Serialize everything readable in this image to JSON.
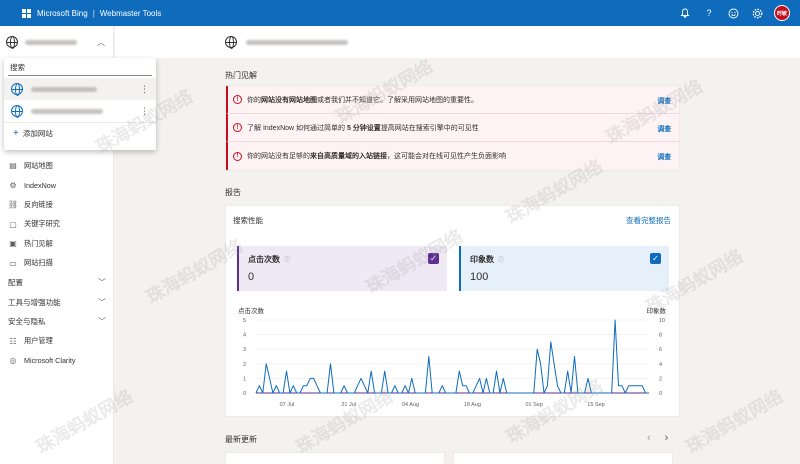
{
  "topbar": {
    "brand": "Microsoft Bing",
    "product": "Webmaster Tools",
    "avatar_initials": "时敏",
    "icons": [
      "bell-icon",
      "help-icon",
      "feedback-icon",
      "settings-icon"
    ],
    "color": "#0f6cbd"
  },
  "sidebar": {
    "dropdown": {
      "search_label": "搜索",
      "add_site": "添加网站"
    },
    "nav_items": [
      {
        "label": "网站地图",
        "icon": "sitemap-icon"
      },
      {
        "label": "IndexNow",
        "icon": "indexnow-icon"
      },
      {
        "label": "反向链接",
        "icon": "backlinks-icon"
      },
      {
        "label": "关键字研究",
        "icon": "keyword-research-icon"
      },
      {
        "label": "热门见解",
        "icon": "insights-icon"
      },
      {
        "label": "网站扫描",
        "icon": "site-scan-icon"
      }
    ],
    "nav_groups": [
      {
        "label": "配置"
      },
      {
        "label": "工具与增强功能"
      },
      {
        "label": "安全与隐私"
      }
    ],
    "nav_tail": [
      {
        "label": "用户管理",
        "icon": "user-management-icon"
      },
      {
        "label": "Microsoft Clarity",
        "icon": "clarity-icon"
      }
    ]
  },
  "insights": {
    "title": "热门见解",
    "rows": [
      {
        "pre": "你的",
        "bold": "网站没有网站地图",
        "post": "或者我们并不知道它。了解采用网站地图的重要性。",
        "action": "调查"
      },
      {
        "pre": "了解 IndexNow 如何通过简单的 ",
        "bold": "5 分钟设置",
        "post": "提高网站在搜索引擎中的可见性",
        "action": "调查"
      },
      {
        "pre": "你的网站没有足够的",
        "bold": "来自高质量域的入站链接",
        "post": "，这可能会对在线可见性产生负面影响",
        "action": "调查"
      }
    ]
  },
  "report": {
    "title": "报告",
    "card_title": "搜索性能",
    "link": "查看完整报告",
    "clicks": {
      "label": "点击次数",
      "value": "0",
      "checked": true,
      "color": "#5c2e91"
    },
    "impressions": {
      "label": "印象数",
      "value": "100",
      "checked": true,
      "color": "#0f6cbd"
    }
  },
  "chart_data": {
    "type": "line",
    "ylabel_left": "点击次数",
    "ylabel_right": "印象数",
    "ylim_left": [
      0,
      5
    ],
    "ylim_right": [
      0,
      10
    ],
    "yticks_left": [
      "0",
      "1",
      "2",
      "3",
      "4",
      "5"
    ],
    "yticks_right": [
      "0",
      "2",
      "4",
      "6",
      "8",
      "10"
    ],
    "xtick_labels": [
      "07 Jul",
      "21 Jul",
      "04 Aug",
      "18 Aug",
      "01 Sep",
      "15 Sep"
    ],
    "x_start": "2024-06-30",
    "x_end": "2024-09-27",
    "xtick_dates": [
      "2024-07-07",
      "2024-07-21",
      "2024-08-04",
      "2024-08-18",
      "2024-09-01",
      "2024-09-15"
    ],
    "series": [
      {
        "name": "点击次数",
        "axis": "left",
        "color": "#5c2e91",
        "values": [
          0,
          0,
          0,
          0,
          0,
          0,
          0,
          0,
          0,
          0,
          0,
          0,
          0,
          0,
          0,
          0,
          0,
          0,
          0,
          0,
          0,
          0,
          0,
          0,
          0,
          0,
          0,
          0,
          0,
          0,
          0,
          0,
          0,
          0,
          0,
          0,
          0,
          0,
          0,
          0,
          0,
          0,
          0,
          0,
          0,
          0,
          0,
          0,
          0,
          0,
          0,
          0,
          0,
          0,
          0,
          0,
          0,
          0,
          0,
          0,
          0,
          0,
          0,
          0,
          0,
          0,
          0,
          0,
          0,
          0,
          0,
          0,
          0,
          0,
          0,
          0,
          0,
          0,
          0,
          0,
          0,
          0,
          0,
          0,
          0,
          0,
          0,
          0,
          0
        ]
      },
      {
        "name": "印象数",
        "axis": "right",
        "color": "#0f6cbd",
        "values": [
          0,
          1,
          0,
          4,
          2,
          0,
          1,
          0,
          0,
          3,
          0,
          1,
          0,
          0,
          1,
          1,
          2,
          2,
          1,
          0,
          0,
          0,
          4,
          0,
          0,
          0,
          1,
          0,
          0,
          0,
          1,
          2,
          1,
          0,
          3,
          0,
          0,
          0,
          3,
          0,
          0,
          1,
          0,
          0,
          1,
          0,
          2,
          0,
          0,
          0,
          0,
          5,
          0,
          0,
          0,
          1,
          0,
          0,
          0,
          0,
          3,
          1,
          1,
          0,
          0,
          1,
          2,
          0,
          2,
          0,
          0,
          3,
          0,
          2,
          0,
          0,
          0,
          0,
          0,
          0,
          0,
          0,
          0,
          6,
          4,
          0,
          1,
          7,
          4,
          1,
          0,
          0,
          3,
          0,
          5,
          0,
          0,
          0,
          2,
          0,
          0,
          0,
          0,
          0,
          0,
          0,
          10,
          1,
          1,
          0,
          1,
          1,
          1,
          1,
          1,
          0,
          0
        ]
      }
    ]
  },
  "recent": {
    "title": "最新更新"
  },
  "watermark": "珠海蚂蚁网络"
}
